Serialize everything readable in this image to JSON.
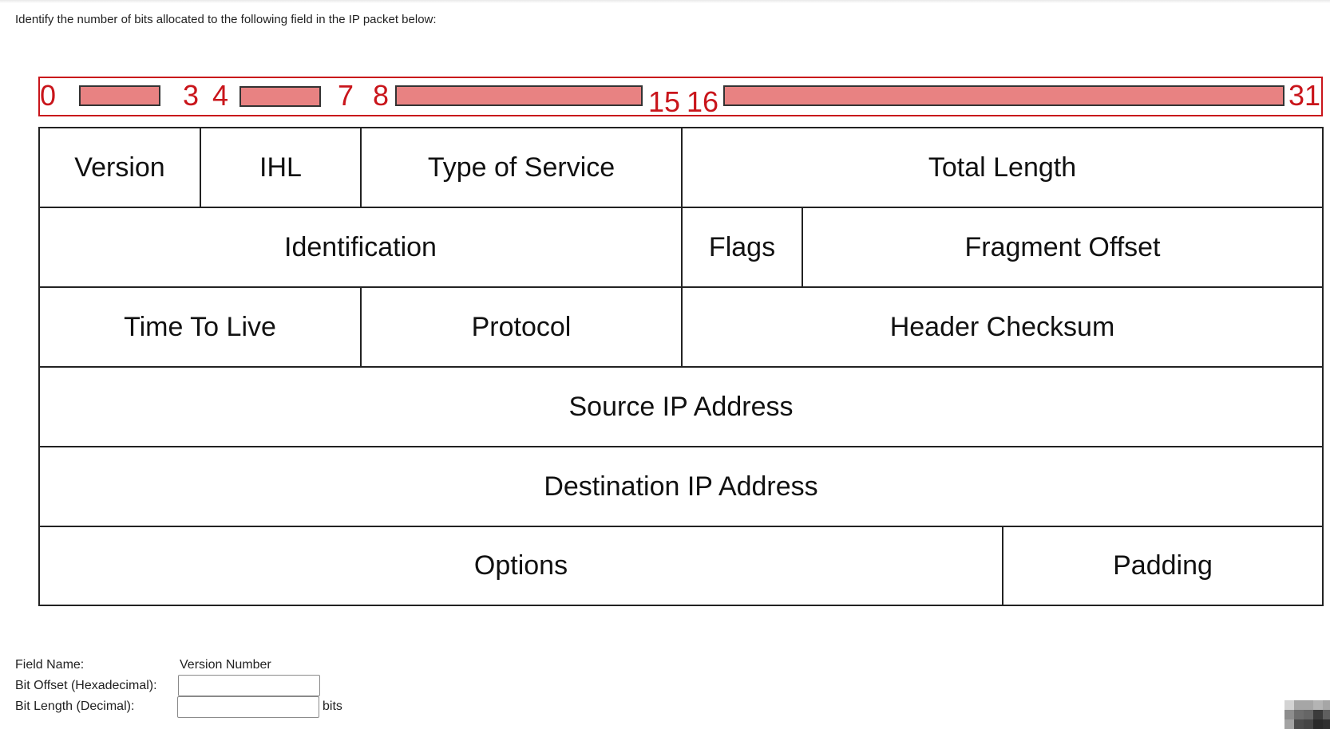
{
  "question": "Identify the number of bits allocated to the following field in the IP packet below:",
  "ruler": {
    "color": "#c9151b",
    "bar_fill": "#e88282",
    "labels": [
      "0",
      "3",
      "4",
      "7",
      "8",
      "15",
      "16",
      "31"
    ],
    "segments": [
      {
        "start_bit": "0",
        "end_bit": "3"
      },
      {
        "start_bit": "4",
        "end_bit": "7"
      },
      {
        "start_bit": "8",
        "end_bit": "15"
      },
      {
        "start_bit": "16",
        "end_bit": "31"
      }
    ]
  },
  "table": {
    "rows": [
      [
        {
          "label": "Version",
          "bits": 4
        },
        {
          "label": "IHL",
          "bits": 4
        },
        {
          "label": "Type of Service",
          "bits": 8
        },
        {
          "label": "Total Length",
          "bits": 16
        }
      ],
      [
        {
          "label": "Identification",
          "bits": 16
        },
        {
          "label": "Flags",
          "bits": 3
        },
        {
          "label": "Fragment Offset",
          "bits": 13
        }
      ],
      [
        {
          "label": "Time To Live",
          "bits": 8
        },
        {
          "label": "Protocol",
          "bits": 8
        },
        {
          "label": "Header Checksum",
          "bits": 16
        }
      ],
      [
        {
          "label": "Source IP Address",
          "bits": 32
        }
      ],
      [
        {
          "label": "Destination IP Address",
          "bits": 32
        }
      ],
      [
        {
          "label": "Options",
          "bits": 24
        },
        {
          "label": "Padding",
          "bits": 8
        }
      ]
    ]
  },
  "form": {
    "field_name_label": "Field Name:",
    "field_name_value": "Version Number",
    "bit_offset_label": "Bit Offset (Hexadecimal):",
    "bit_offset_value": "",
    "bit_length_label": "Bit Length (Decimal):",
    "bit_length_value": "",
    "bit_length_unit": "bits"
  },
  "badge": {
    "icon": "pixelated-logo-icon",
    "pixels": [
      [
        "#d3d3d3",
        "#a6a6a6",
        "#a6a6a6",
        "#b4b4b4",
        "#a6a6a6"
      ],
      [
        "#8d8d8d",
        "#6d6d6d",
        "#666666",
        "#3b3b3b",
        "#5f5f5f"
      ],
      [
        "#a3a3a3",
        "#4c4c4c",
        "#454545",
        "#2a2a2a",
        "#303030"
      ]
    ]
  }
}
